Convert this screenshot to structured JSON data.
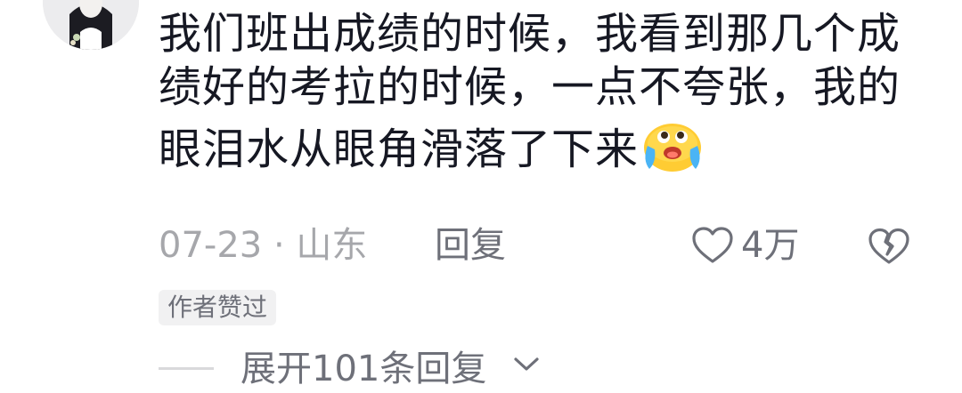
{
  "comment": {
    "text": "我们班出成绩的时候，我看到那几个成绩好的考拉的时候，一点不夸张，我的眼泪水从眼角滑落了下来",
    "emoji_icon": "crying-laughing-face-emoji",
    "date": "07-23",
    "separator": "·",
    "location": "山东",
    "reply_label": "回复",
    "like_count": "4万",
    "author_badge": "作者赞过",
    "expand_label": "展开101条回复"
  },
  "icons": {
    "like": "heart-outline-icon",
    "dislike": "broken-heart-icon",
    "expand": "chevron-down-icon"
  },
  "colors": {
    "text_primary": "#161823",
    "text_meta": "#a6a7ab",
    "text_secondary": "#6e7079",
    "badge_bg": "#f1f1f2",
    "divider": "#d9d9db",
    "emoji_yellow": "#ffcc33",
    "emoji_tear": "#4ab4f5"
  }
}
